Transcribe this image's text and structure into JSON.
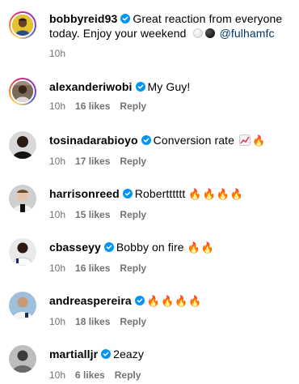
{
  "comments": [
    {
      "username": "bobbyreid93",
      "text": "Great reaction from everyone today. Enjoy your weekend",
      "mention": "@fulhamfc",
      "time": "10h",
      "likes": "",
      "reply": ""
    },
    {
      "username": "alexanderiwobi",
      "text": "My Guy!",
      "time": "10h",
      "likes": "16 likes",
      "reply": "Reply"
    },
    {
      "username": "tosinadarabioyo",
      "text": "Conversion rate",
      "emoji": "🔥",
      "time": "10h",
      "likes": "17 likes",
      "reply": "Reply"
    },
    {
      "username": "harrisonreed",
      "text": "Robertttttt",
      "emoji": "🔥🔥🔥🔥",
      "time": "10h",
      "likes": "15 likes",
      "reply": "Reply"
    },
    {
      "username": "cbasseyy",
      "text": "Bobby on fire",
      "emoji": "🔥🔥",
      "time": "10h",
      "likes": "16 likes",
      "reply": "Reply"
    },
    {
      "username": "andreaspereira",
      "text": "",
      "emoji": "🔥🔥🔥🔥",
      "time": "10h",
      "likes": "18 likes",
      "reply": "Reply"
    },
    {
      "username": "martialljr",
      "text": "2eazy",
      "time": "10h",
      "likes": "6 likes",
      "reply": "Reply"
    }
  ],
  "colors": {
    "verified": "#0095f6",
    "meta": "#737373",
    "mention": "#00376b",
    "story_ring": "#d62976"
  },
  "icons": [
    "verified-badge-icon",
    "white-circle-emoji",
    "black-circle-emoji",
    "chart-increasing-emoji",
    "fire-emoji"
  ]
}
